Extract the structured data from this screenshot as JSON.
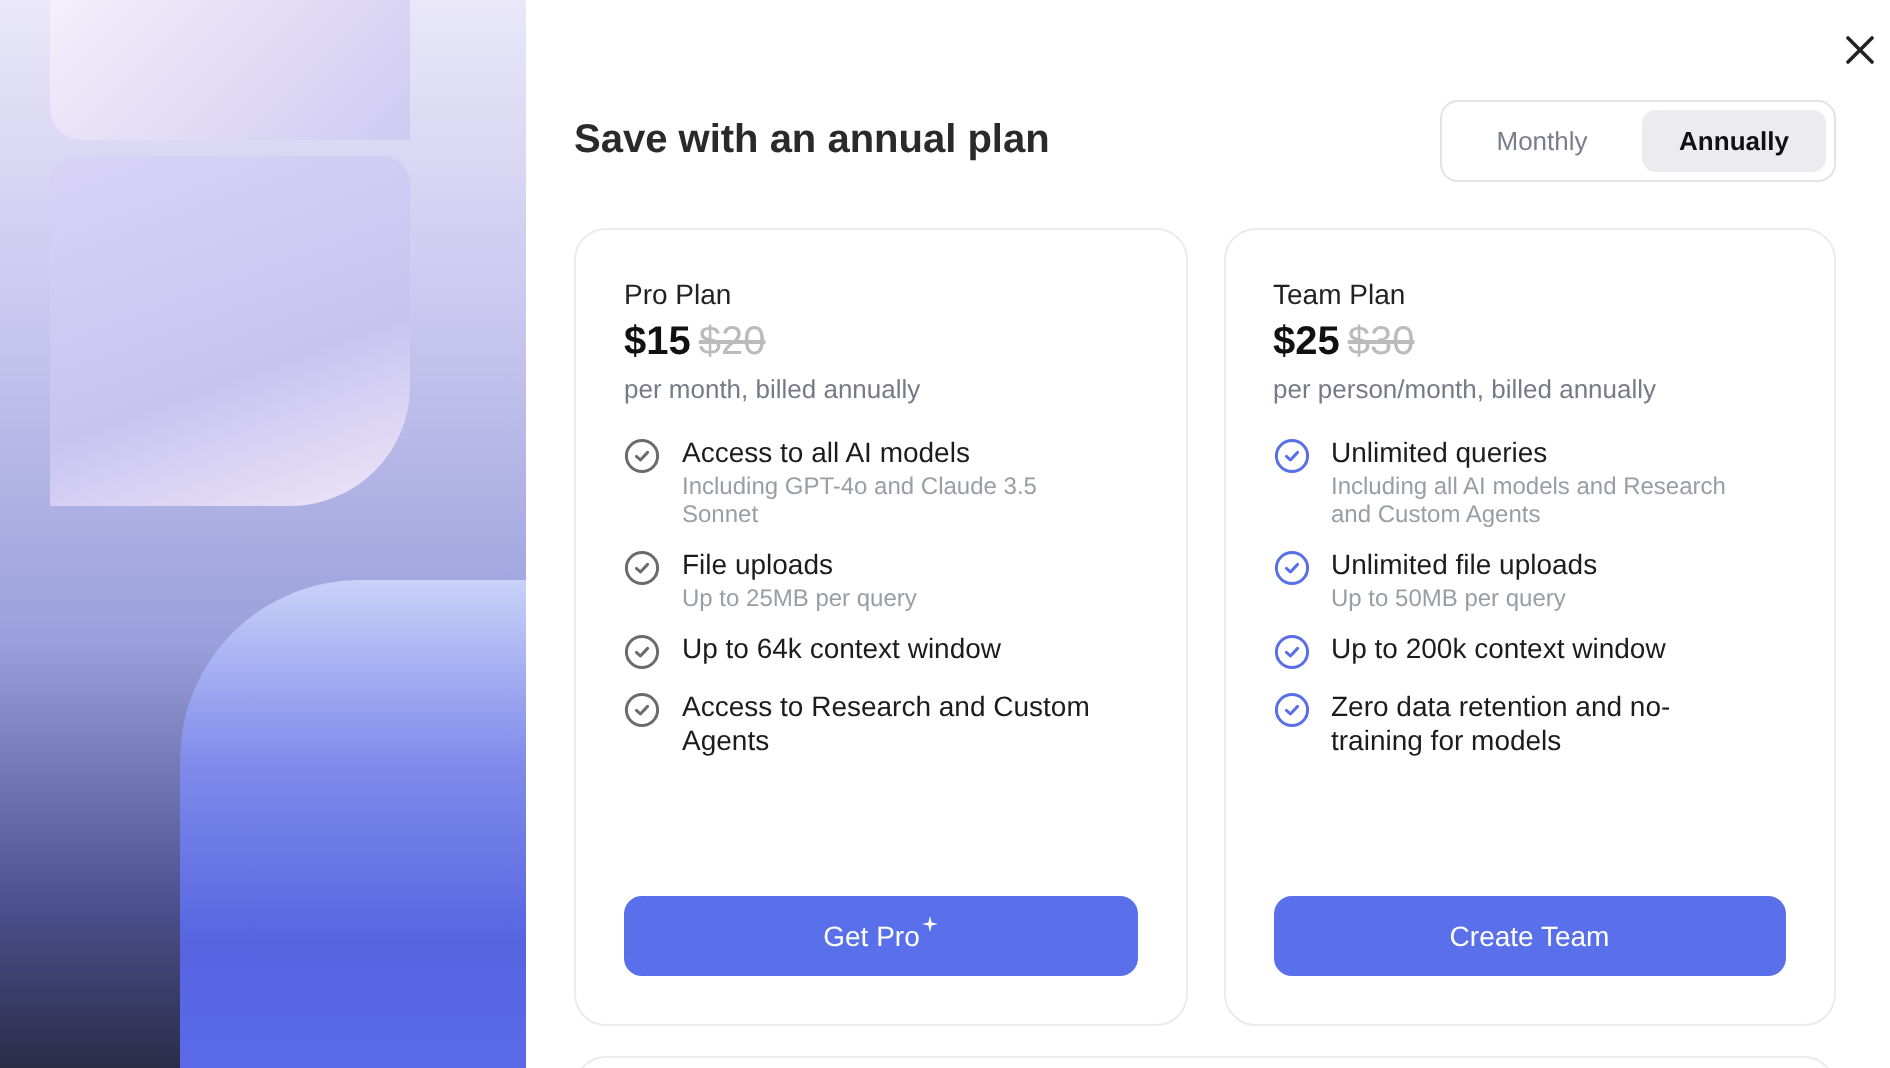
{
  "heading": "Save with an annual plan",
  "billing_toggle": [
    {
      "label": "Monthly",
      "selected": false
    },
    {
      "label": "Annually",
      "selected": true
    }
  ],
  "plans": [
    {
      "name": "Pro Plan",
      "price": "$15",
      "old_price": "$20",
      "billing": "per month, billed annually",
      "color": "#6b6b6b",
      "features": [
        {
          "title": "Access to all AI models",
          "detail": "Including GPT-4o and Claude 3.5 Sonnet"
        },
        {
          "title": "File uploads",
          "detail": "Up to 25MB per query"
        },
        {
          "title": "Up to 64k context window"
        },
        {
          "title": "Access to Research and Custom Agents"
        }
      ],
      "button": {
        "label": "Get Pro",
        "sparkle": true
      }
    },
    {
      "name": "Team Plan",
      "price": "$25",
      "old_price": "$30",
      "billing": "per person/month, billed annually",
      "color": "#5a6ee8",
      "features": [
        {
          "title": "Unlimited queries",
          "detail": "Including all AI models and Research and Custom Agents"
        },
        {
          "title": "Unlimited file uploads",
          "detail": "Up to 50MB per query"
        },
        {
          "title": "Up to 200k context window"
        },
        {
          "title": "Zero data retention and no-training for models"
        }
      ],
      "button": {
        "label": "Create Team",
        "sparkle": false
      }
    }
  ]
}
